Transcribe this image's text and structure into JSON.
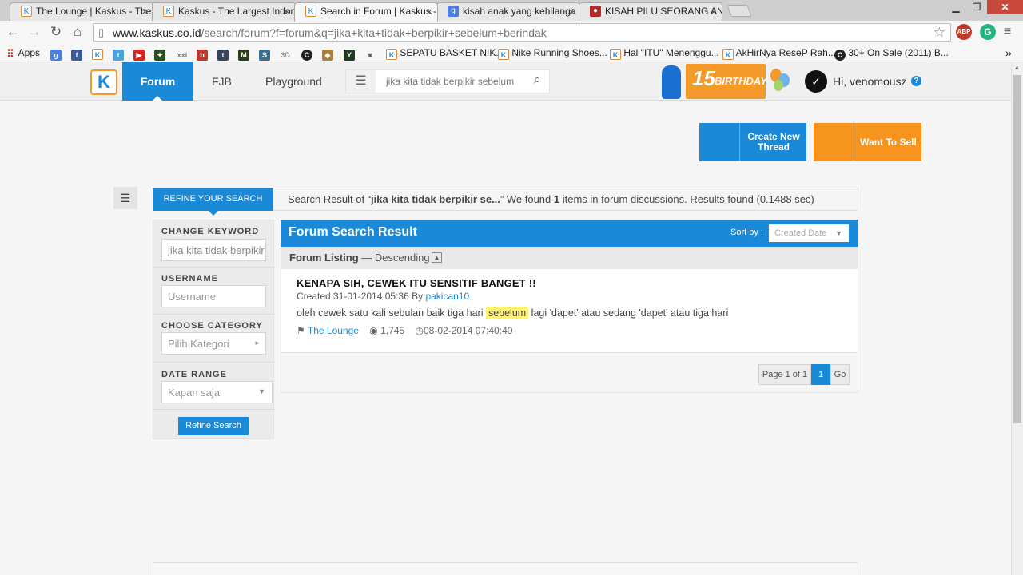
{
  "browser": {
    "tabs": [
      {
        "title": "The Lounge | Kaskus - The",
        "icon": "kaskus-icon",
        "active": false
      },
      {
        "title": "Kaskus - The Largest Indon",
        "icon": "kaskus-icon",
        "active": false
      },
      {
        "title": "Search in Forum | Kaskus -",
        "icon": "kaskus-icon",
        "active": true
      },
      {
        "title": "kisah anak yang kehilanga",
        "icon": "google-icon",
        "active": false
      },
      {
        "title": "KISAH PILU SEORANG AN",
        "icon": "news-icon",
        "active": false
      }
    ],
    "url_host": "www.kaskus.co.id",
    "url_path": "/search/forum?f=forum&q=jika+kita+tidak+berpikir+sebelum+berindak",
    "extension_badge": "ABP",
    "bookmarks": [
      {
        "label": "Apps",
        "icon": "apps-grid-icon"
      },
      {
        "label": "",
        "icon": "google-icon"
      },
      {
        "label": "",
        "icon": "facebook-icon"
      },
      {
        "label": "",
        "icon": "kaskus-icon"
      },
      {
        "label": "",
        "icon": "twitter-icon"
      },
      {
        "label": "",
        "icon": "youtube-icon"
      },
      {
        "label": "",
        "icon": "game-icon"
      },
      {
        "label": "",
        "icon": "xxi-icon"
      },
      {
        "label": "",
        "icon": "b-icon"
      },
      {
        "label": "",
        "icon": "tumblr-icon"
      },
      {
        "label": "",
        "icon": "m-icon"
      },
      {
        "label": "",
        "icon": "s-icon"
      },
      {
        "label": "",
        "icon": "3d-icon"
      },
      {
        "label": "",
        "icon": "c-icon"
      },
      {
        "label": "",
        "icon": "shield-icon"
      },
      {
        "label": "",
        "icon": "y-icon"
      },
      {
        "label": "",
        "icon": "camera-icon"
      },
      {
        "label": "SEPATU BASKET NIK...",
        "icon": "kaskus-icon"
      },
      {
        "label": "Nike Running Shoes...",
        "icon": "kaskus-icon"
      },
      {
        "label": "Hal \"ITU\" Menenggu...",
        "icon": "kaskus-icon"
      },
      {
        "label": "AkHirNya ReseP Rah...",
        "icon": "kaskus-icon"
      },
      {
        "label": "30+ On Sale (2011) B...",
        "icon": "c-icon"
      }
    ]
  },
  "site": {
    "nav": {
      "forum": "Forum",
      "fjb": "FJB",
      "playground": "Playground"
    },
    "search_value": "jika kita tidak berpikir sebelum",
    "birthday": {
      "number": "15",
      "text": "BIRTHDAY"
    },
    "greeting": "Hi, venomousz",
    "help": "?",
    "create_thread": "Create New Thread",
    "want_to_sell": "Want To Sell"
  },
  "search": {
    "refine_header": "REFINE YOUR SEARCH",
    "result_prefix": "Search Result of “",
    "result_query": "jika kita tidak berpikir se...",
    "result_middle": "” We found ",
    "result_count": "1",
    "result_suffix": " items in forum discussions. Results found (0.1488 sec)",
    "panel": {
      "keyword_label": "CHANGE KEYWORD",
      "keyword_value": "jika kita tidak berpikir",
      "username_label": "USERNAME",
      "username_placeholder": "Username",
      "category_label": "CHOOSE CATEGORY",
      "category_value": "Pilih Kategori",
      "daterange_label": "DATE RANGE",
      "daterange_value": "Kapan saja",
      "refine_button": "Refine Search"
    },
    "main": {
      "title": "Forum Search Result",
      "sort_label": "Sort by :",
      "sort_value": "Created Date",
      "listing_label": "Forum Listing",
      "listing_order": " — Descending"
    },
    "result": {
      "title": "KENAPA SIH, CEWEK ITU SENSITIF BANGET !!",
      "created_prefix": "Created 31-01-2014 05:36 By ",
      "author": "pakican10",
      "snippet_before": "oleh cewek satu kali sebulan baik tiga hari ",
      "snippet_highlight": "sebelum",
      "snippet_after": " lagi 'dapet' atau sedang 'dapet' atau tiga hari",
      "forum": "The Lounge",
      "views": "1,745",
      "last_post": "08-02-2014 07:40:40"
    },
    "pager": {
      "info": "Page 1 of 1",
      "current": "1",
      "go": "Go"
    }
  },
  "colors": {
    "brand_blue": "#1a8ad8",
    "brand_orange": "#f7941d",
    "highlight": "#fff26e"
  }
}
